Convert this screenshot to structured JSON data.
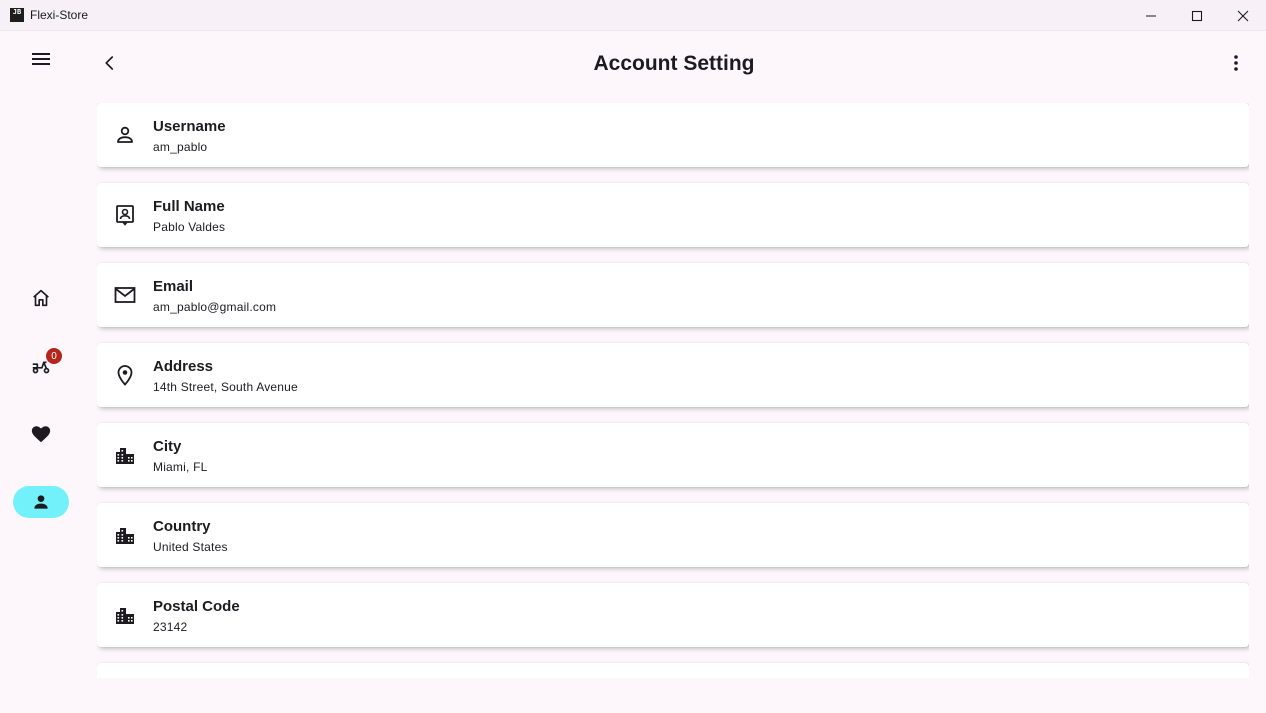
{
  "window": {
    "app_icon_text": "JB",
    "title": "Flexi-Store",
    "controls": [
      "minimize-icon",
      "maximize-icon",
      "close-icon"
    ]
  },
  "rail": {
    "menu_icon": "menu-icon",
    "items": [
      {
        "name": "home",
        "icon": "home-icon",
        "active": false
      },
      {
        "name": "cart",
        "icon": "delivery-scooter-icon",
        "badge": "0",
        "active": false
      },
      {
        "name": "favorites",
        "icon": "heart-icon",
        "active": false
      },
      {
        "name": "account",
        "icon": "person-icon",
        "active": true
      }
    ],
    "active_color": "#73f1fb",
    "badge_color": "#b3261e"
  },
  "header": {
    "title": "Account Setting",
    "back_icon": "chevron-left-icon",
    "more_icon": "more-vertical-icon"
  },
  "fields": [
    {
      "label": "Username",
      "value": "am_pablo",
      "icon": "person-outline-icon"
    },
    {
      "label": "Full Name",
      "value": "Pablo Valdes",
      "icon": "contact-card-icon"
    },
    {
      "label": "Email",
      "value": "am_pablo@gmail.com",
      "icon": "mail-icon"
    },
    {
      "label": "Address",
      "value": "14th Street, South Avenue",
      "icon": "location-pin-icon"
    },
    {
      "label": "City",
      "value": "Miami, FL",
      "icon": "city-icon"
    },
    {
      "label": "Country",
      "value": "United States",
      "icon": "city-icon"
    },
    {
      "label": "Postal Code",
      "value": "23142",
      "icon": "city-icon"
    }
  ]
}
